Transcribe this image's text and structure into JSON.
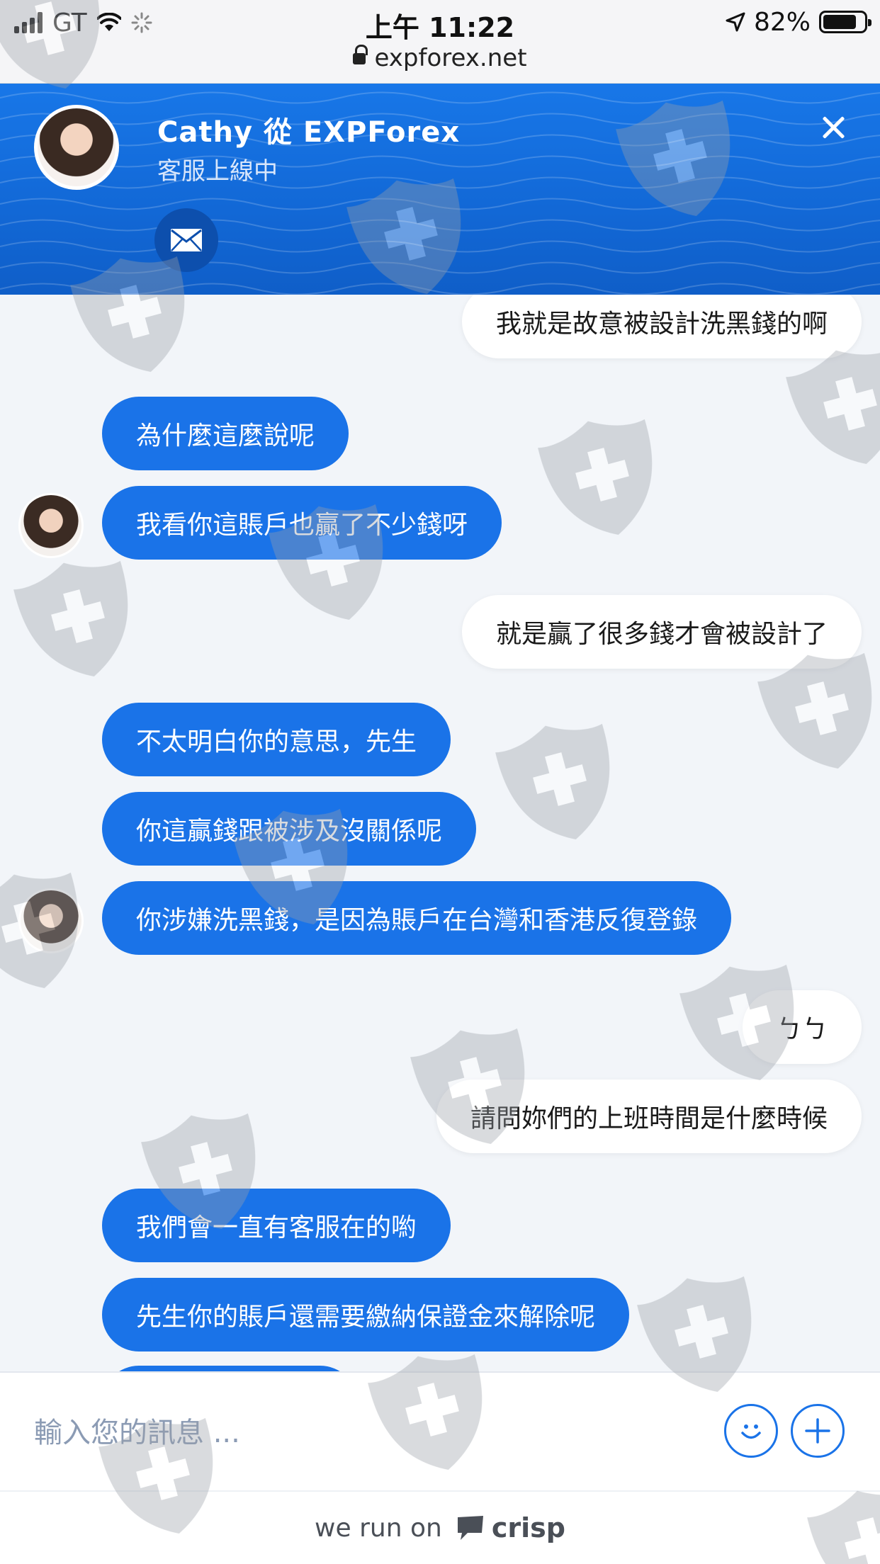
{
  "status_bar": {
    "carrier": "GT",
    "time": "上午 11:22",
    "battery": "82%",
    "battery_level": 0.82,
    "url": "expforex.net"
  },
  "header": {
    "title": "Cathy 從 EXPForex",
    "status": "客服上線中"
  },
  "messages": [
    {
      "from": "user",
      "text": "我就是故意被設計洗黑錢的啊"
    },
    {
      "from": "operator",
      "text": "為什麼這麼說呢"
    },
    {
      "from": "operator",
      "text": "我看你這賬戶也贏了不少錢呀"
    },
    {
      "from": "user",
      "text": "就是贏了很多錢才會被設計了"
    },
    {
      "from": "operator",
      "text": "不太明白你的意思，先生"
    },
    {
      "from": "operator",
      "text": "你這贏錢跟被涉及沒關係呢"
    },
    {
      "from": "operator",
      "text": "你涉嫌洗黑錢，是因為賬戶在台灣和香港反復登錄"
    },
    {
      "from": "user",
      "text": "ㄅㄅ"
    },
    {
      "from": "user",
      "text": "請問妳們的上班時間是什麼時候"
    },
    {
      "from": "operator",
      "text": "我們會一直有客服在的喲"
    },
    {
      "from": "operator",
      "text": "先生你的賬戶還需要繳納保證金來解除呢"
    }
  ],
  "composer": {
    "placeholder": "輸入您的訊息 ..."
  },
  "footer": {
    "prefix": "we run on",
    "brand": "crisp"
  },
  "colors": {
    "accent": "#1a73e8",
    "header": "#1268d6"
  }
}
